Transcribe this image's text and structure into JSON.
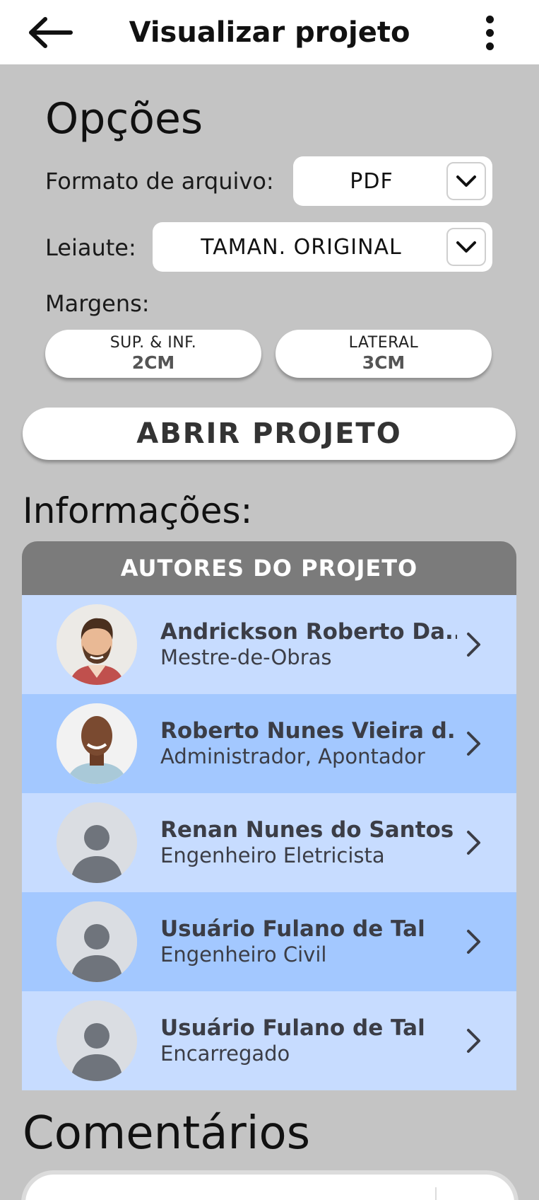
{
  "header": {
    "title": "Visualizar projeto",
    "back_icon": "arrow-left-icon",
    "menu_icon": "kebab-menu-icon"
  },
  "options": {
    "title": "Opções",
    "file_format": {
      "label": "Formato de arquivo:",
      "value": "PDF"
    },
    "layout": {
      "label": "Leiaute:",
      "value": "TAMAN. ORIGINAL"
    },
    "margins": {
      "label": "Margens:",
      "top_bottom": {
        "label": "SUP. & INF.",
        "value": "2CM"
      },
      "lateral": {
        "label": "LATERAL",
        "value": "3CM"
      }
    },
    "open_button": "ABRIR PROJETO"
  },
  "info": {
    "title": "Informações:",
    "authors_header": "AUTORES DO PROJETO",
    "authors": [
      {
        "name": "Andrickson Roberto Da...",
        "role": "Mestre-de-Obras"
      },
      {
        "name": "Roberto Nunes Vieira d...",
        "role": "Administrador, Apontador"
      },
      {
        "name": "Renan Nunes do Santos",
        "role": "Engenheiro Eletricista"
      },
      {
        "name": "Usuário Fulano de Tal",
        "role": "Engenheiro Civil"
      },
      {
        "name": "Usuário Fulano de Tal",
        "role": "Encarregado"
      }
    ]
  },
  "comments": {
    "title": "Comentários"
  },
  "colors": {
    "background": "#c4c4c4",
    "header_bar": "#7b7b7b",
    "row_light": "#c7dcff",
    "row_dark": "#a3c8ff"
  }
}
